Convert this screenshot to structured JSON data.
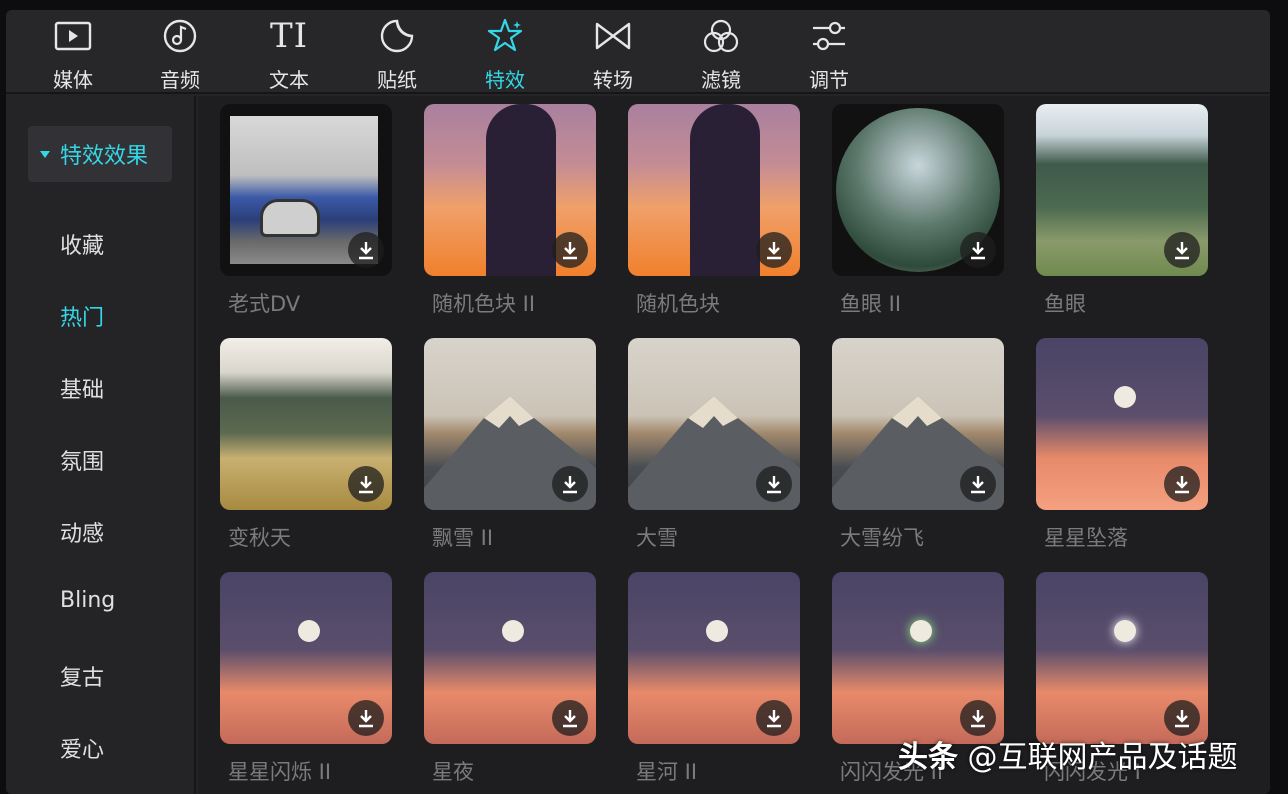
{
  "toolbar": {
    "items": [
      {
        "label": "媒体",
        "icon": "media-icon"
      },
      {
        "label": "音频",
        "icon": "audio-icon"
      },
      {
        "label": "文本",
        "icon": "text-icon"
      },
      {
        "label": "贴纸",
        "icon": "sticker-icon"
      },
      {
        "label": "特效",
        "icon": "effects-icon",
        "active": true
      },
      {
        "label": "转场",
        "icon": "transition-icon"
      },
      {
        "label": "滤镜",
        "icon": "filter-icon"
      },
      {
        "label": "调节",
        "icon": "adjust-icon"
      }
    ],
    "text_icon_glyph": "TI"
  },
  "sidebar": {
    "header": "特效效果",
    "items": [
      {
        "label": "收藏"
      },
      {
        "label": "热门",
        "active": true
      },
      {
        "label": "基础"
      },
      {
        "label": "氛围"
      },
      {
        "label": "动感"
      },
      {
        "label": "Bling"
      },
      {
        "label": "复古"
      },
      {
        "label": "爱心"
      }
    ]
  },
  "effects": [
    {
      "label": "老式DV"
    },
    {
      "label": "随机色块 II"
    },
    {
      "label": "随机色块"
    },
    {
      "label": "鱼眼 II"
    },
    {
      "label": "鱼眼"
    },
    {
      "label": "变秋天"
    },
    {
      "label": "飘雪 II"
    },
    {
      "label": "大雪"
    },
    {
      "label": "大雪纷飞"
    },
    {
      "label": "星星坠落"
    },
    {
      "label": "星星闪烁 II"
    },
    {
      "label": "星夜"
    },
    {
      "label": "星河 II"
    },
    {
      "label": "闪闪发光 II"
    },
    {
      "label": "闪闪发光 I"
    }
  ],
  "watermark": {
    "brand": "头条",
    "handle": "@互联网产品及话题"
  },
  "colors": {
    "accent": "#35d7e6",
    "background": "#242427",
    "label": "#7b7b7e"
  }
}
